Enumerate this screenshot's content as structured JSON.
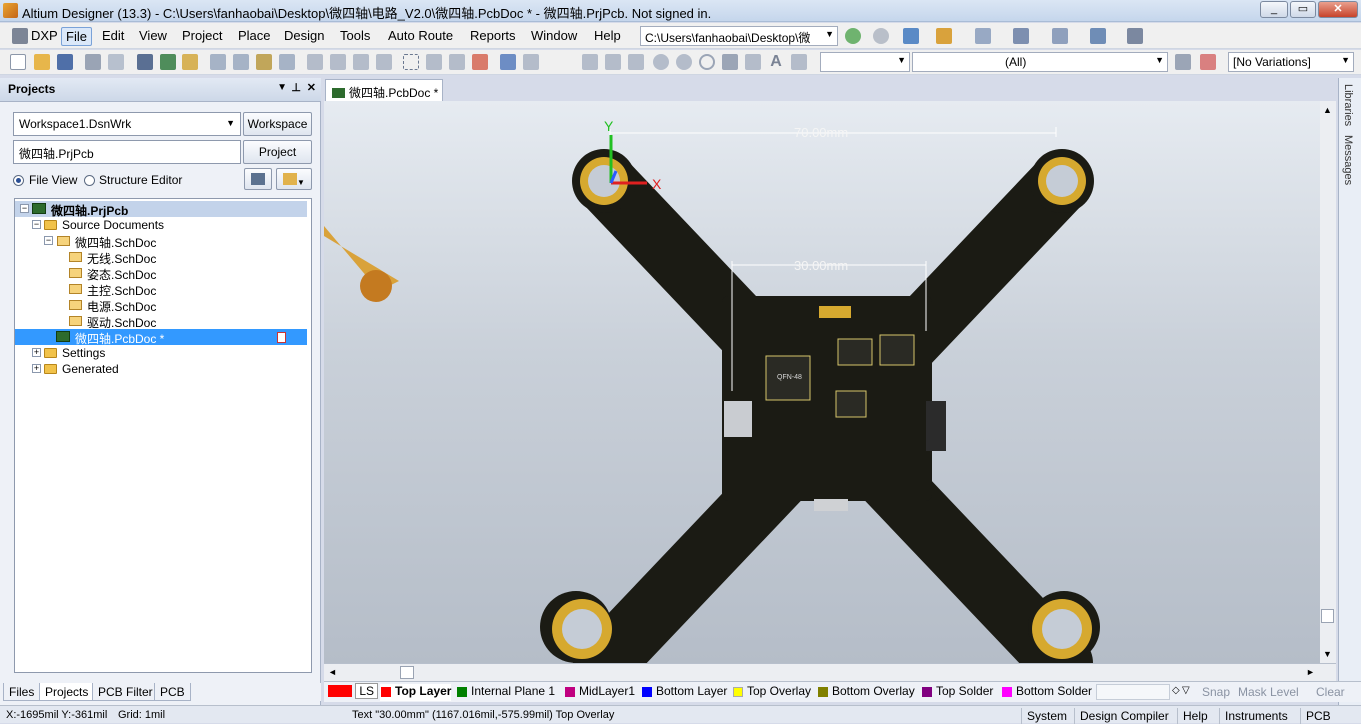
{
  "window": {
    "title": "Altium Designer (13.3) - C:\\Users\\fanhaobai\\Desktop\\微四轴\\电路_V2.0\\微四轴.PcbDoc * - 微四轴.PrjPcb. Not signed in."
  },
  "menu": {
    "items": [
      "DXP",
      "File",
      "Edit",
      "View",
      "Project",
      "Place",
      "Design",
      "Tools",
      "Auto Route",
      "Reports",
      "Window",
      "Help"
    ],
    "path_combo": "C:\\Users\\fanhaobai\\Desktop\\微"
  },
  "toolbar2": {
    "filter_combo": "(All)",
    "variations_combo": "[No Variations]"
  },
  "panel": {
    "title": "Projects",
    "workspace_field": "Workspace1.DsnWrk",
    "workspace_button": "Workspace",
    "project_field": "微四轴.PrjPcb",
    "project_button": "Project",
    "file_view_label": "File View",
    "structure_editor_label": "Structure Editor",
    "tree": [
      "微四轴.PrjPcb",
      "Source Documents",
      "微四轴.SchDoc",
      "无线.SchDoc",
      "姿态.SchDoc",
      "主控.SchDoc",
      "电源.SchDoc",
      "驱动.SchDoc",
      "微四轴.PcbDoc *",
      "Settings",
      "Generated"
    ]
  },
  "bottom_tabs": [
    "Files",
    "Projects",
    "PCB Filter",
    "PCB"
  ],
  "doc_tab": {
    "label": "微四轴.PcbDoc *"
  },
  "right_strip": {
    "libraries": "Libraries",
    "messages": "Messages"
  },
  "canvas": {
    "dim_outer": "70.00mm",
    "dim_inner": "30.00mm",
    "chip_label": "QFN-48"
  },
  "layers": [
    {
      "label": "LS",
      "color": "#ff0000"
    },
    {
      "label": "Top Layer",
      "color": "#ff0000"
    },
    {
      "label": "Internal Plane 1",
      "color": "#008000"
    },
    {
      "label": "MidLayer1",
      "color": "#c00080"
    },
    {
      "label": "Bottom Layer",
      "color": "#0000ff"
    },
    {
      "label": "Top Overlay",
      "color": "#ffff00"
    },
    {
      "label": "Bottom Overlay",
      "color": "#808000"
    },
    {
      "label": "Top Solder",
      "color": "#800080"
    },
    {
      "label": "Bottom Solder",
      "color": "#ff00ff"
    }
  ],
  "layer_controls": {
    "snap": "Snap",
    "mask_level": "Mask Level",
    "clear": "Clear"
  },
  "status": {
    "coords": "X:-1695mil Y:-361mil",
    "grid": "Grid: 1mil",
    "selection": "Text \"30.00mm\" (1167.016mil,-575.99mil)  Top Overlay",
    "buttons": [
      "System",
      "Design Compiler",
      "Help",
      "Instruments",
      "PCB"
    ]
  }
}
